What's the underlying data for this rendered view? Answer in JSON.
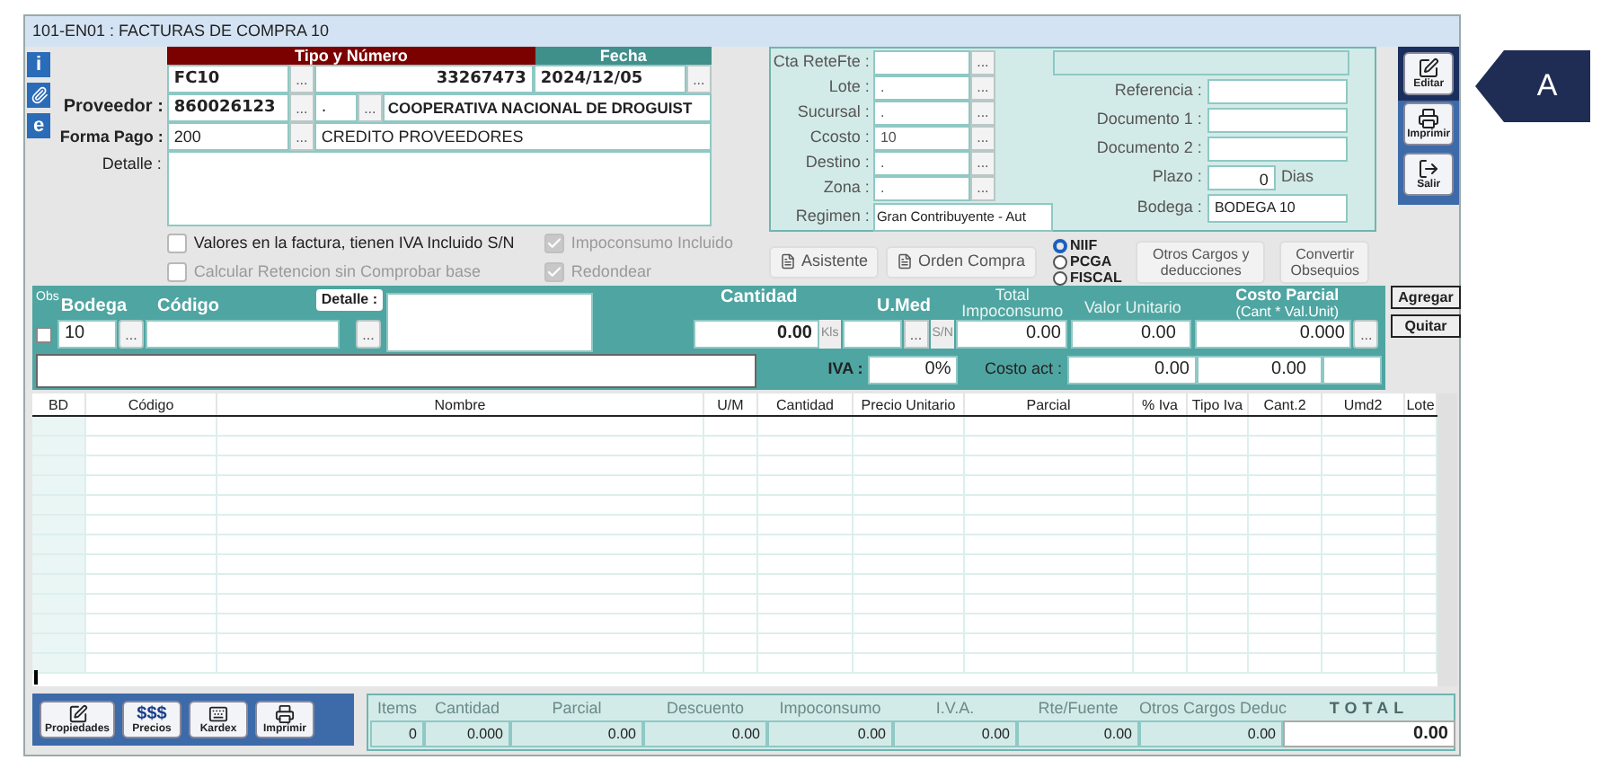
{
  "window": {
    "title": "101-EN01 : FACTURAS DE COMPRA 10"
  },
  "side_icons": [
    {
      "kind": "glyph",
      "glyph": "i"
    },
    {
      "kind": "clip"
    },
    {
      "kind": "glyph",
      "glyph": "e"
    }
  ],
  "header": {
    "tipo_numero_label": "Tipo y Número",
    "fecha_label": "Fecha",
    "tipo": "FC10",
    "tipo_lookup": "...",
    "numero": "33267473",
    "fecha": "2024/12/05",
    "fecha_lookup": "..."
  },
  "proveedor": {
    "label": "Proveedor :",
    "nit": "860026123",
    "nit_lookup": "...",
    "sucursal": ".",
    "sucursal_lookup": "...",
    "nombre": "COOPERATIVA NACIONAL DE DROGUIST"
  },
  "forma_pago": {
    "label": "Forma Pago :",
    "code": "200",
    "lookup": "...",
    "name": "CREDITO PROVEEDORES"
  },
  "detalle": {
    "label": "Detalle :"
  },
  "checkboxes": [
    {
      "label": "Valores en la factura, tienen  IVA Incluido S/N",
      "checked": false,
      "disabled": false
    },
    {
      "label": "Calcular Retencion sin Comprobar base",
      "checked": false,
      "disabled": true
    },
    {
      "label": "Impoconsumo Incluido",
      "checked": true,
      "disabled": true
    },
    {
      "label": "Redondear",
      "checked": true,
      "disabled": true
    }
  ],
  "mid_fields": [
    {
      "label": "Cta ReteFte :",
      "lookup": "..."
    },
    {
      "label": "Lote :",
      "value": ".",
      "lookup": "..."
    },
    {
      "label": "Sucursal :",
      "value": ".",
      "lookup": "..."
    },
    {
      "label": "Ccosto :",
      "value": "10",
      "lookup": "..."
    },
    {
      "label": "Destino :",
      "value": ".",
      "lookup": "..."
    },
    {
      "label": "Zona :",
      "value": ".",
      "lookup": "..."
    }
  ],
  "regimen": {
    "label": "Regimen :",
    "value": "Gran Contribuyente - Aut"
  },
  "ref_fields": [
    {
      "label": "Referencia :"
    },
    {
      "label": "Documento 1 :"
    },
    {
      "label": "Documento 2 :"
    }
  ],
  "plazo": {
    "label": "Plazo :",
    "value": "0",
    "unit": "Dias"
  },
  "bodega": {
    "label": "Bodega :",
    "value": "BODEGA 10"
  },
  "action_buttons": [
    "Asistente",
    "Orden Compra"
  ],
  "norma_radios": [
    {
      "label": "NIIF",
      "selected": true
    },
    {
      "label": "PCGA",
      "selected": false
    },
    {
      "label": "FISCAL",
      "selected": false
    }
  ],
  "extra_buttons": [
    "Otros Cargos y deducciones",
    "Convertir Obsequios"
  ],
  "toolbar": [
    {
      "label": "Editar",
      "kind": "edit"
    },
    {
      "label": "Imprimir",
      "kind": "print"
    },
    {
      "label": "Salir",
      "kind": "exit"
    }
  ],
  "entry": {
    "obs_label": "Obs",
    "obs_checked": false,
    "bodega_label": "Bodega",
    "bodega": "10",
    "bodega_lookup": "...",
    "codigo_label": "Código",
    "codigo_lookup": "...",
    "detalle_label": "Detalle :",
    "cantidad_label": "Cantidad",
    "cantidad": "0.00",
    "unit": "Kls",
    "umed_label": "U.Med",
    "umed_lookup": "...",
    "sn": "S/N",
    "total_imp_label": "Total Impoconsumo",
    "total_imp": "0.00",
    "valor_unit_label": "Valor Unitario",
    "valor_unit": "0.00",
    "costo_parcial_label": "Costo Parcial",
    "costo_parcial_sub": "(Cant * Val.Unit)",
    "costo_parcial": "0.000",
    "costo_lookup": "...",
    "iva_label": "IVA :",
    "iva": "0%",
    "costo_act_label": "Costo act :",
    "costo_act": "0.00",
    "costo_act_2": "0.00"
  },
  "entry_buttons": [
    "Agregar",
    "Quitar"
  ],
  "grid": {
    "columns": [
      "BD",
      "Código",
      "Nombre",
      "U/M",
      "Cantidad",
      "Precio Unitario",
      "Parcial",
      "% Iva",
      "Tipo Iva",
      "Cant.2",
      "Umd2",
      "Lote"
    ]
  },
  "bottom_buttons": [
    {
      "label": "Propiedades",
      "kind": "props"
    },
    {
      "label": "Precios",
      "kind": "glyph",
      "glyph": "$$$"
    },
    {
      "label": "Kardex",
      "kind": "kardex"
    },
    {
      "label": "Imprimir",
      "kind": "print"
    }
  ],
  "totals": [
    {
      "label": "Items",
      "value": "0"
    },
    {
      "label": "Cantidad",
      "value": "0.000"
    },
    {
      "label": "Parcial",
      "value": "0.00"
    },
    {
      "label": "Descuento",
      "value": "0.00"
    },
    {
      "label": "Impoconsumo",
      "value": "0.00"
    },
    {
      "label": "I.V.A.",
      "value": "0.00"
    },
    {
      "label": "Rte/Fuente",
      "value": "0.00"
    },
    {
      "label": "Otros Cargos Deduc",
      "value": "0.00"
    },
    {
      "label": "TOTAL",
      "value": "0.00",
      "kind": "grand"
    }
  ],
  "callout": {
    "label": "A"
  }
}
